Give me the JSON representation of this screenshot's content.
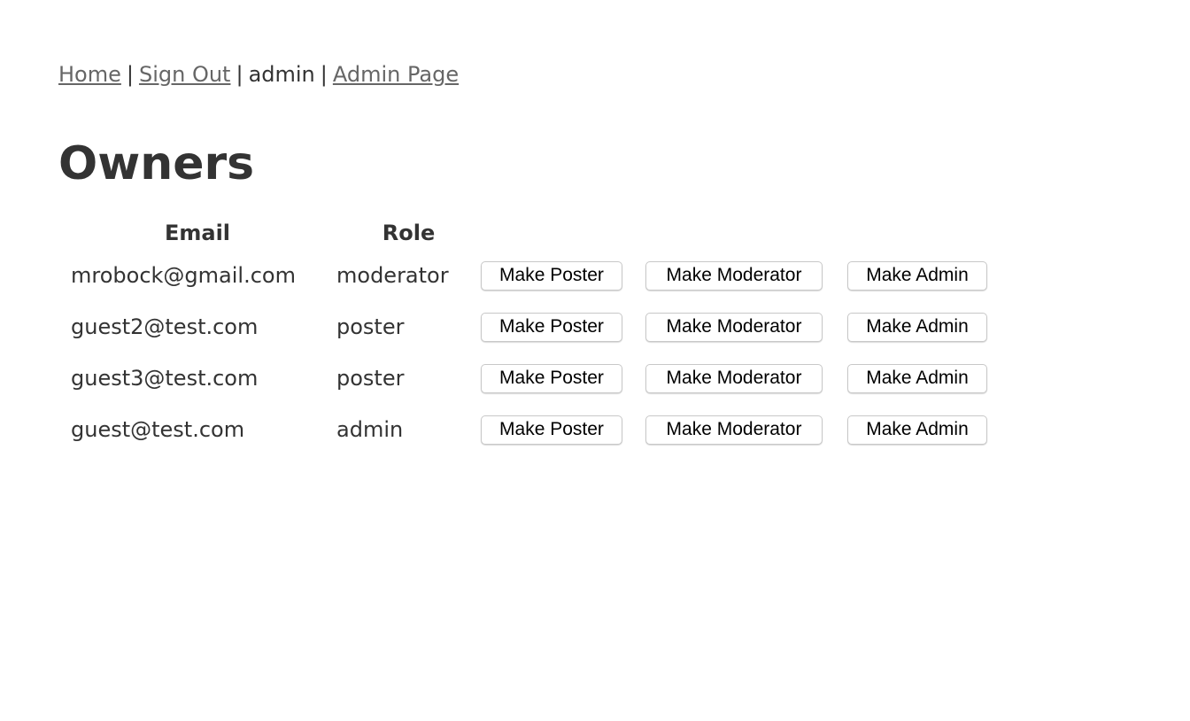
{
  "nav": {
    "home": "Home",
    "sign_out": "Sign Out",
    "user": "admin",
    "admin_page": "Admin Page",
    "separator": "|"
  },
  "page_title": "Owners",
  "table": {
    "headers": [
      "Email",
      "Role"
    ],
    "rows": [
      {
        "email": "mrobock@gmail.com",
        "role": "moderator"
      },
      {
        "email": "guest2@test.com",
        "role": "poster"
      },
      {
        "email": "guest3@test.com",
        "role": "poster"
      },
      {
        "email": "guest@test.com",
        "role": "admin"
      }
    ],
    "actions": {
      "make_poster": "Make Poster",
      "make_moderator": "Make Moderator",
      "make_admin": "Make Admin"
    }
  }
}
